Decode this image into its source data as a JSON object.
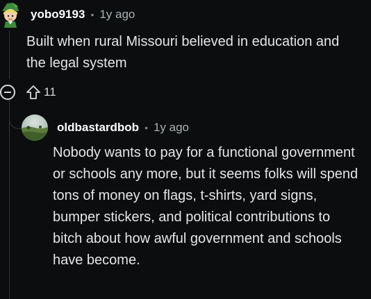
{
  "comments": [
    {
      "username": "yobo9193",
      "separator": "•",
      "age": "1y ago",
      "body": "Built when rural Missouri believed in education and the legal system",
      "upvotes": "11"
    },
    {
      "username": "oldbastardbob",
      "separator": "•",
      "age": "1y ago",
      "body": "Nobody wants to pay for a functional government or schools any more, but it seems folks will spend tons of money on flags, t-shirts, yard signs, bumper stickers, and political contributions to bitch about how awful government and schools have become."
    }
  ],
  "icons": {
    "collapse": "collapse-thread-icon",
    "upvote": "upvote-arrow-icon"
  },
  "colors": {
    "background": "#0b0d0e",
    "text": "#e4e6e7",
    "muted": "#aab0b4",
    "thread_line": "#343536"
  }
}
